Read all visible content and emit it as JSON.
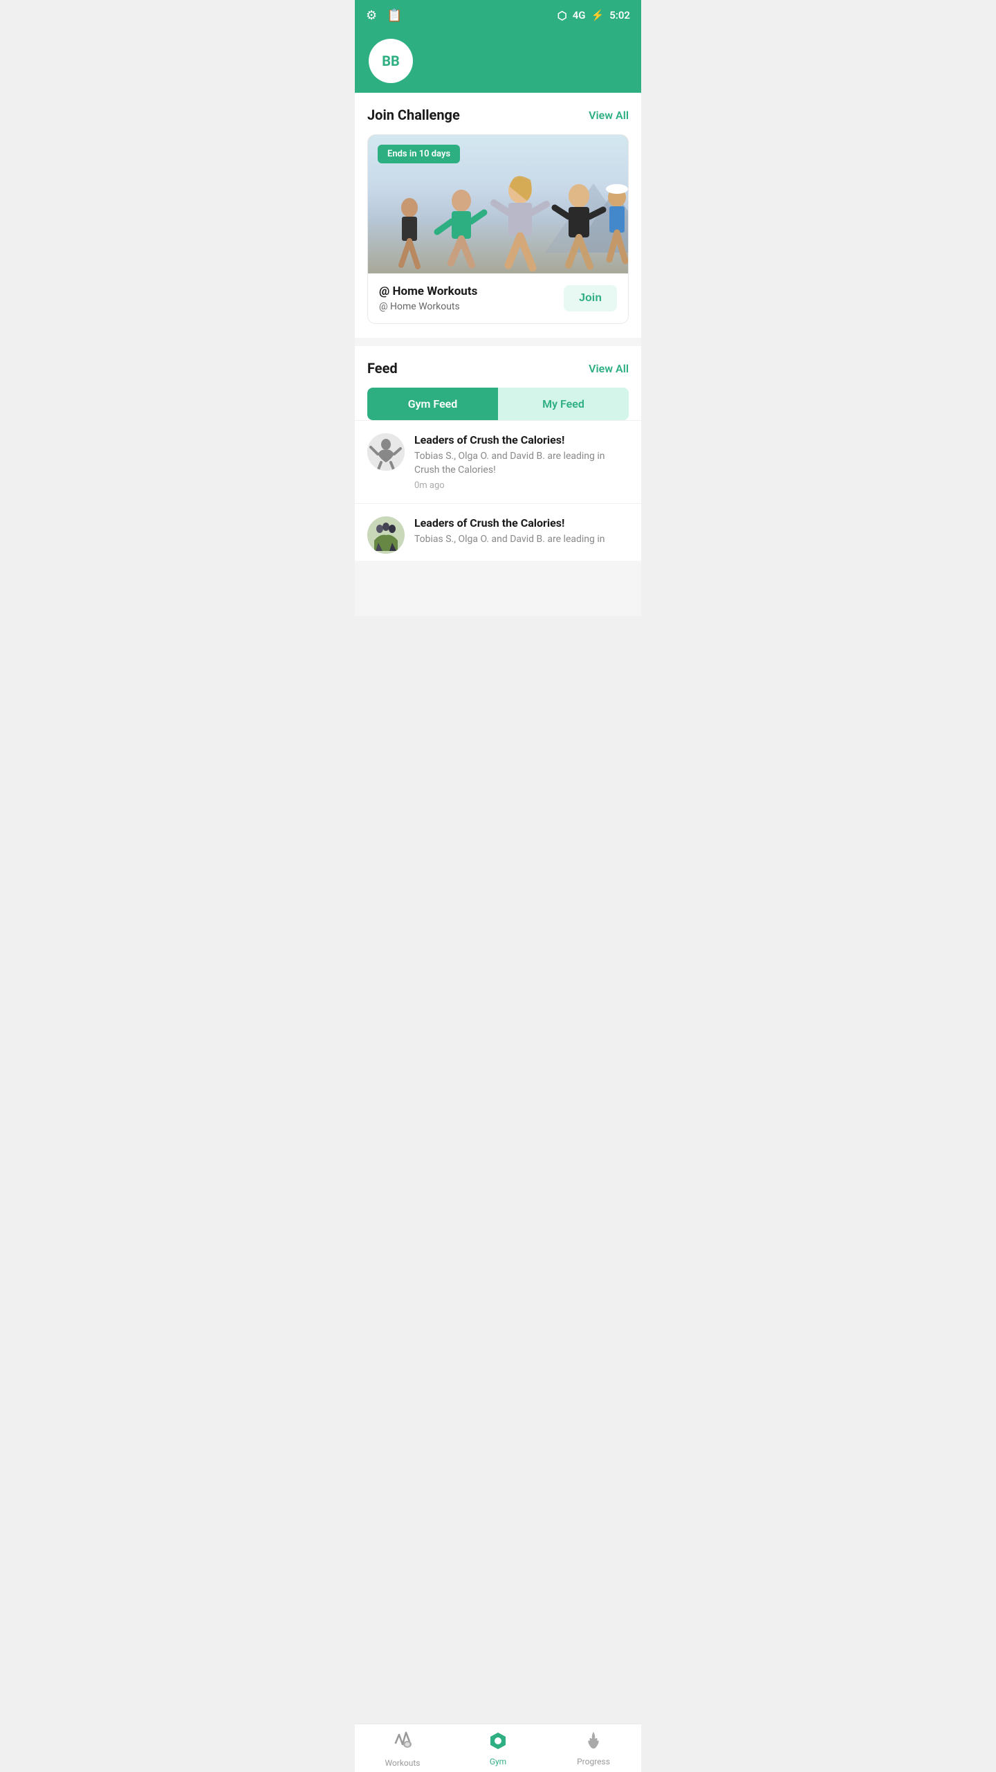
{
  "statusBar": {
    "time": "5:02",
    "battery": "⚡",
    "signal": "4G"
  },
  "header": {
    "avatarText": "BB"
  },
  "challenge": {
    "sectionTitle": "Join Challenge",
    "viewAllLabel": "View All",
    "badge": "Ends in 10 days",
    "workoutTitle": "@ Home Workouts",
    "workoutSubtitle": "@ Home Workouts",
    "joinLabel": "Join"
  },
  "feed": {
    "sectionTitle": "Feed",
    "viewAllLabel": "View All",
    "tabs": [
      {
        "label": "Gym Feed",
        "active": true
      },
      {
        "label": "My Feed",
        "active": false
      }
    ],
    "items": [
      {
        "title": "Leaders of Crush the Calories!",
        "description": "Tobias S., Olga O. and David B. are leading in Crush the Calories!",
        "time": "0m ago"
      },
      {
        "title": "Leaders of Crush the Calories!",
        "description": "Tobias S., Olga O. and David B. are leading in",
        "time": ""
      }
    ]
  },
  "bottomNav": {
    "items": [
      {
        "label": "Workouts",
        "active": false,
        "icon": "👟"
      },
      {
        "label": "Gym",
        "active": true,
        "icon": "🔷"
      },
      {
        "label": "Progress",
        "active": false,
        "icon": "🔥"
      }
    ]
  }
}
